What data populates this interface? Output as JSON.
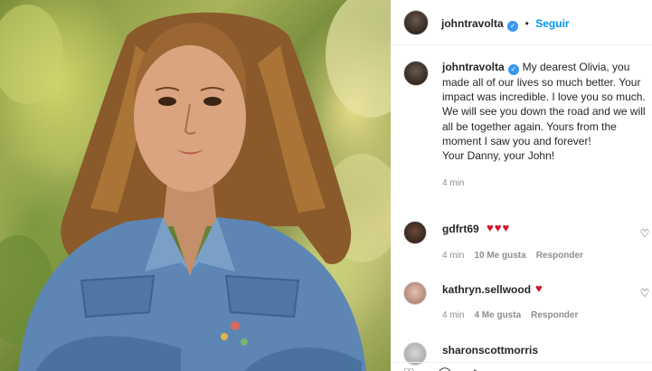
{
  "post": {
    "username": "johntravolta",
    "separator": "•",
    "follow_label": "Seguir"
  },
  "caption": {
    "username": "johntravolta",
    "text": "My dearest Olivia, you made all of our lives so much better. Your impact was incredible. I love you so much. We will see you down the road and we will all be together again. Yours from the moment I saw you and forever!",
    "signoff": "Your Danny, your John!",
    "time": "4 min"
  },
  "comments": [
    {
      "username": "gdfrt69",
      "emojis": "♥♥♥",
      "time": "4 min",
      "likes": "10 Me gusta",
      "reply_label": "Responder"
    },
    {
      "username": "kathryn.sellwood",
      "emojis": "♥",
      "time": "4 min",
      "likes": "4 Me gusta",
      "reply_label": "Responder"
    },
    {
      "username": "sharonscottmorris"
    }
  ],
  "icons": {
    "verified": "verified-badge-icon",
    "like": "heart-outline-icon",
    "comment": "comment-bubble-icon",
    "share": "paper-plane-icon"
  },
  "colors": {
    "accent": "#0095f6",
    "verified": "#3897f0",
    "heart": "#d2132a",
    "muted": "#8e8e8e"
  }
}
